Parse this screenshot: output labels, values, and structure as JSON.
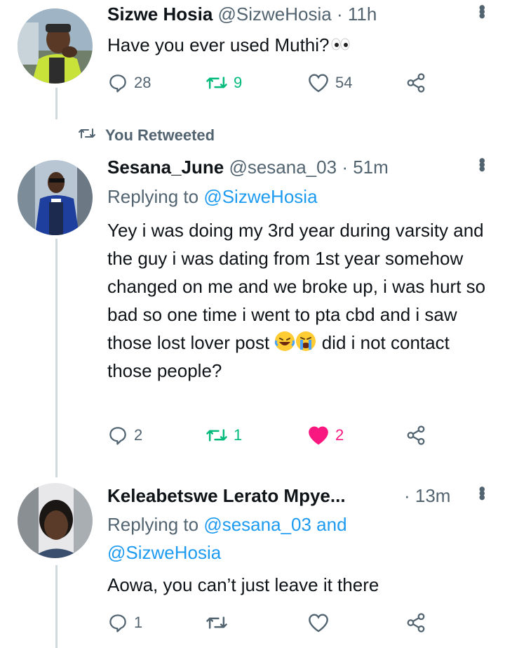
{
  "tweets": [
    {
      "name": "Sizwe Hosia",
      "handle": "@SizweHosia",
      "time": "· 11h",
      "text": "Have you ever used Muthi?",
      "replies": "28",
      "retweets": "9",
      "likes": "54",
      "retweet_color": "#00ba7c",
      "like_color": "#536471"
    },
    {
      "retweet_label": "You Retweeted",
      "name": "Sesana_June",
      "handle": "@sesana_03",
      "time": "· 51m",
      "replying_prefix": "Replying to ",
      "replying_handles": "@SizweHosia",
      "text_part1": "Yey i was doing my 3rd year during varsity and the guy i was dating from 1st year somehow changed on me and we broke up, i was hurt so bad so one time i went to pta cbd and i saw those lost lover post",
      "text_part2": "did i not contact those people?",
      "replies": "2",
      "retweets": "1",
      "likes": "2",
      "retweet_color": "#00ba7c",
      "like_color": "#f91880"
    },
    {
      "name": "Keleabetswe Lerato Mpye...",
      "time": "· 13m",
      "replying_prefix": "Replying to ",
      "replying_handle1": "@sesana_03",
      "replying_and": " and",
      "replying_handle2": "@SizweHosia",
      "text": "Aowa, you can’t just leave it there",
      "replies": "1",
      "retweets": "",
      "likes": ""
    }
  ],
  "icons": [
    "reply-icon",
    "retweet-icon",
    "like-icon",
    "share-icon",
    "more-icon",
    "eyes-emoji",
    "laughing-emoji",
    "crying-emoji"
  ],
  "colors": {
    "text": "#0f1419",
    "muted": "#536471",
    "link": "#1d9bf0",
    "retweet": "#00ba7c",
    "like": "#f91880"
  }
}
